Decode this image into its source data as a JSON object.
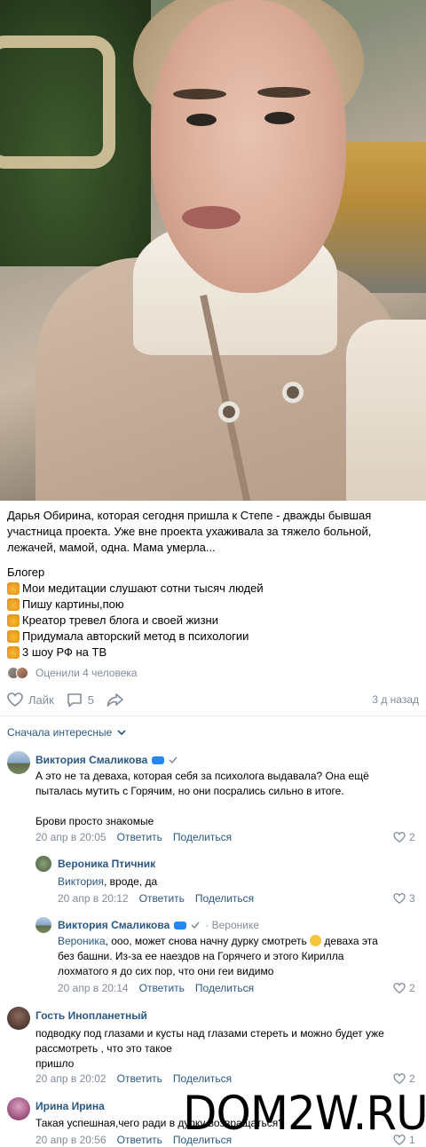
{
  "post": {
    "text_main": "Дарья Обирина, которая сегодня пришла к Степе - дваждыбывшая участница проекта. Уже вне проекта ухаживала за тяжело больной, лежачей, мамой, одна. Мама умерла...",
    "text_line1": "Дарья Обирина, которая сегодня пришла к Степе - дважды бывшая",
    "text_line2": "участница проекта. Уже вне проекта ухаживала за тяжело больной,",
    "text_line3": "лежачей, мамой, одна. Мама умерла...",
    "bio_title": "Блогер",
    "bio_items": [
      "Мои медитации слушают сотни тысяч людей",
      "Пишу картины,пою",
      "Креатор тревел блога и своей жизни",
      "Придумала авторский метод в психологии",
      "3 шоу РФ на ТВ"
    ],
    "rated": "Оценили 4 человека",
    "like_label": "Лайк",
    "comments_count": "5",
    "time_ago": "3 д назад"
  },
  "sort_label": "Сначала интересные",
  "comments": [
    {
      "author": "Виктория Смаликова",
      "text": "А это не та деваха, которая себя за психолога выдавала? Она ещё\nпыталась мутить с Горячим, но они посрались сильно в итоге.\n\nБрови просто знакомые",
      "date": "20 апр в 20:05",
      "reply": "Ответить",
      "share": "Поделиться",
      "likes": "2"
    },
    {
      "author": "Вероника Птичник",
      "mention": "Виктория",
      "text": ", вроде, да",
      "date": "20 апр в 20:12",
      "reply": "Ответить",
      "share": "Поделиться",
      "likes": "3"
    },
    {
      "author": "Виктория Смаликова",
      "reply_to": "Веронике",
      "mention": "Вероника",
      "text_a": ", ооо, может снова начну дурку смотреть ",
      "text_b": " деваха эта",
      "text_c": "без башни. Из-за ее наездов на Горячего и этого Кирилла\nлохматого я до сих пор, что они геи видимо",
      "date": "20 апр в 20:14",
      "reply": "Ответить",
      "share": "Поделиться",
      "likes": "2"
    },
    {
      "author": "Гость Инопланетный",
      "text": "подводку под глазами и кусты над глазами стереть и можно будет уже\nрассмотреть , что это такое\nпришло",
      "date": "20 апр в 20:02",
      "reply": "Ответить",
      "share": "Поделиться",
      "likes": "2"
    },
    {
      "author": "Ирина Ирина",
      "text": "Такая успешная,чего ради в дурку возвращаться?",
      "date": "20 апр в 20:56",
      "reply": "Ответить",
      "share": "Поделиться",
      "likes": "1"
    }
  ],
  "watermark": "DOM2W.RU",
  "colors": {
    "link": "#2a5885",
    "muted": "#818c99",
    "vk_blue": "#2787f5"
  }
}
